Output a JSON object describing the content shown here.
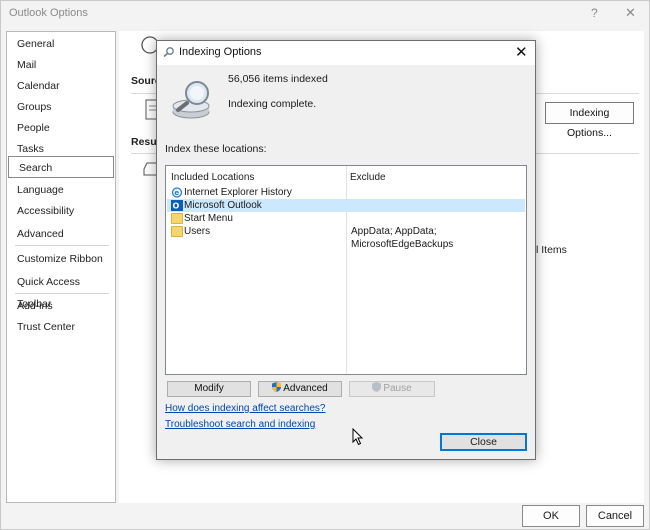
{
  "window": {
    "title": "Outlook Options",
    "help_glyph": "?",
    "close_glyph": "✕"
  },
  "sidebar": {
    "items": [
      {
        "label": "General"
      },
      {
        "label": "Mail"
      },
      {
        "label": "Calendar"
      },
      {
        "label": "Groups"
      },
      {
        "label": "People"
      },
      {
        "label": "Tasks"
      },
      {
        "label": "Search",
        "active": true
      },
      {
        "label": "Language"
      },
      {
        "label": "Accessibility"
      },
      {
        "label": "Advanced"
      },
      {
        "label": "Customize Ribbon"
      },
      {
        "label": "Quick Access Toolbar"
      },
      {
        "label": "Add-ins"
      },
      {
        "label": "Trust Center"
      }
    ]
  },
  "background": {
    "sources_label": "Sourc",
    "results_label": "Result",
    "indexing_options_button": "Indexing Options...",
    "items_text": "l Items"
  },
  "footer": {
    "ok": "OK",
    "cancel": "Cancel"
  },
  "dialog": {
    "title": "Indexing Options",
    "close_glyph": "✕",
    "items_indexed": "56,056 items indexed",
    "status": "Indexing complete.",
    "locations_label": "Index these locations:",
    "columns": {
      "included": "Included Locations",
      "exclude": "Exclude"
    },
    "rows": [
      {
        "name": "Internet Explorer History",
        "exclude": "",
        "icon": "internet-explorer-icon"
      },
      {
        "name": "Microsoft Outlook",
        "exclude": "",
        "icon": "outlook-icon",
        "selected": true
      },
      {
        "name": "Start Menu",
        "exclude": "",
        "icon": "folder-icon"
      },
      {
        "name": "Users",
        "exclude": "AppData; AppData; MicrosoftEdgeBackups",
        "icon": "folder-icon"
      }
    ],
    "buttons": {
      "modify": "Modify",
      "advanced": "Advanced",
      "pause": "Pause",
      "close": "Close"
    },
    "links": {
      "affect": "How does indexing affect searches?",
      "troubleshoot": "Troubleshoot search and indexing"
    }
  },
  "colors": {
    "selection": "#cce8ff",
    "link": "#0645ad",
    "focus": "#0078d7"
  }
}
